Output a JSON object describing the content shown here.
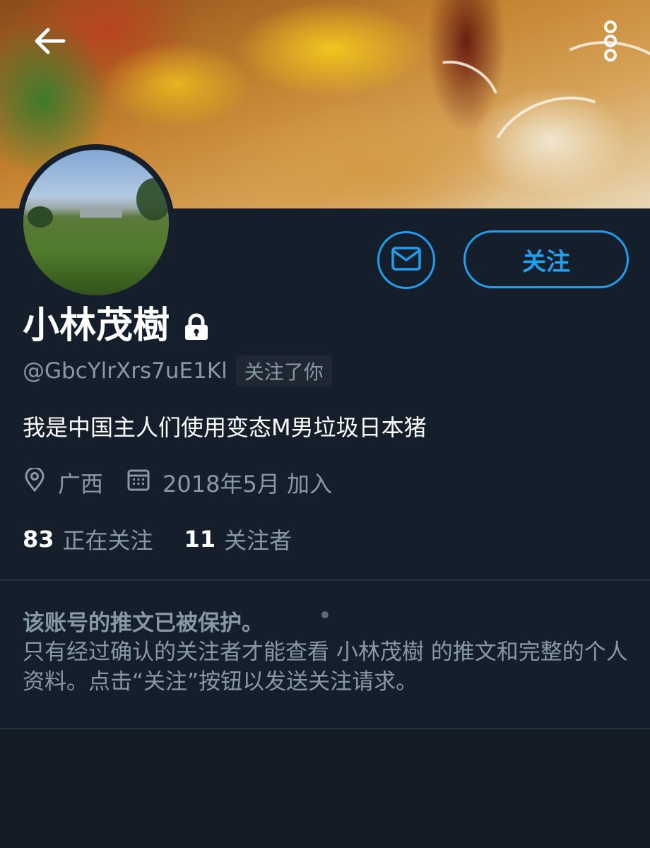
{
  "header": {
    "back_icon": "arrow-left-icon",
    "more_icon": "more-vertical-icon"
  },
  "profile": {
    "display_name": "小林茂樹",
    "lock_icon": "lock-icon",
    "handle": "@GbcYlrXrs7uE1Kl",
    "follows_you_label": "关注了你",
    "bio": "我是中国主人们使用变态M男垃圾日本猪",
    "location": "广西",
    "location_icon": "location-pin-icon",
    "joined": "2018年5月 加入",
    "joined_icon": "calendar-icon"
  },
  "actions": {
    "message_icon": "envelope-icon",
    "follow_label": "关注"
  },
  "stats": {
    "following_count": "83",
    "following_label": "正在关注",
    "followers_count": "11",
    "followers_label": "关注者"
  },
  "protected_notice": {
    "title": "该账号的推文已被保护。",
    "body": "只有经过确认的关注者才能查看 小林茂樹 的推文和完整的个人资料。点击“关注”按钮以发送关注请求。"
  },
  "colors": {
    "background": "#151f2b",
    "accent": "#1da1f2",
    "secondary_text": "#8899a6"
  }
}
